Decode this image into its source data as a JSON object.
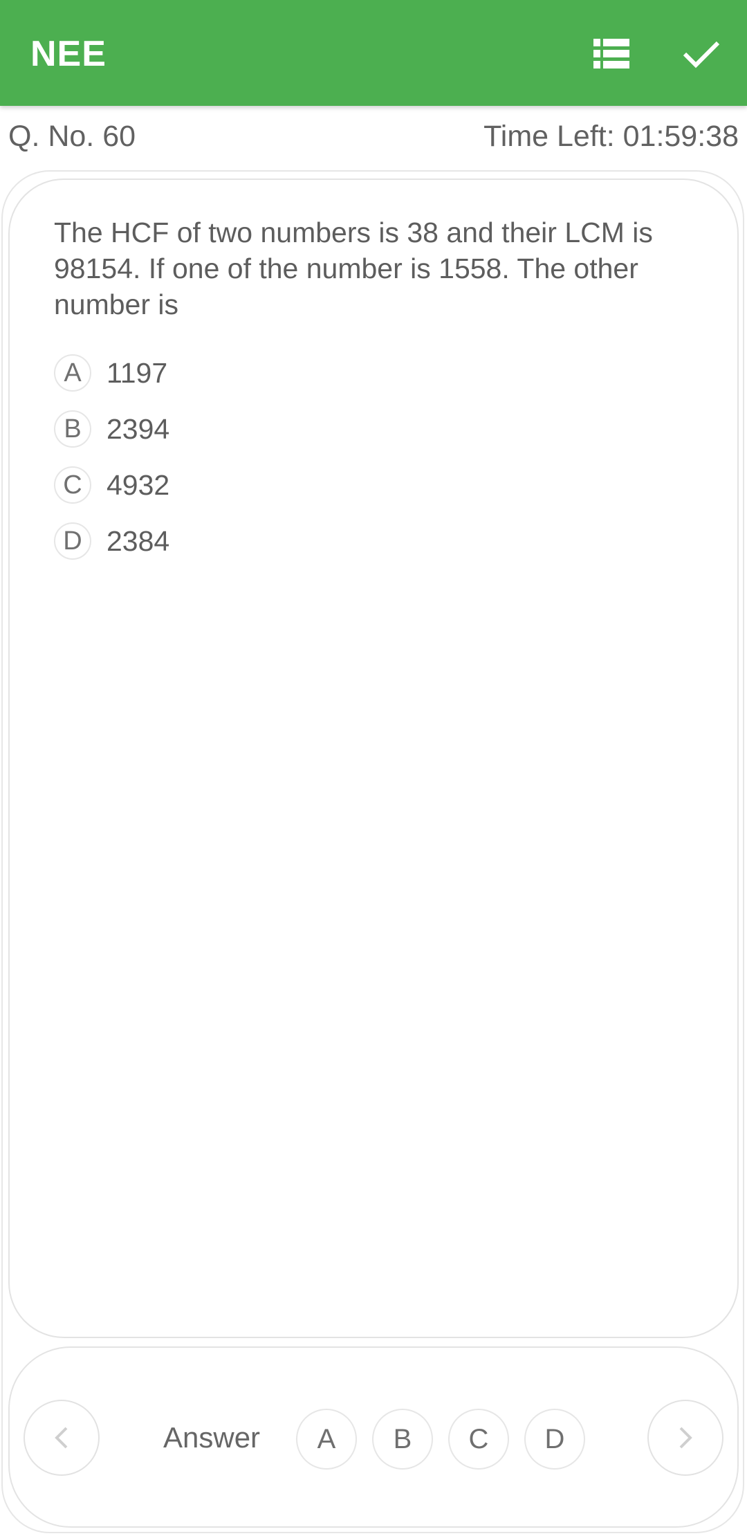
{
  "appbar": {
    "title": "NEE",
    "icons": [
      "list-icon",
      "check-icon"
    ],
    "color": "#4caf50"
  },
  "info": {
    "question_number": "Q. No. 60",
    "time_left": "Time Left: 01:59:38"
  },
  "question": {
    "text": "The HCF of two numbers is 38 and their LCM is 98154. If one of the number is 1558. The other number is",
    "options": [
      {
        "letter": "A",
        "value": "1197"
      },
      {
        "letter": "B",
        "value": "2394"
      },
      {
        "letter": "C",
        "value": "4932"
      },
      {
        "letter": "D",
        "value": "2384"
      }
    ]
  },
  "answer_bar": {
    "label": "Answer",
    "choices": [
      "A",
      "B",
      "C",
      "D"
    ],
    "prev_icon": "chevron-left-icon",
    "next_icon": "chevron-right-icon"
  }
}
